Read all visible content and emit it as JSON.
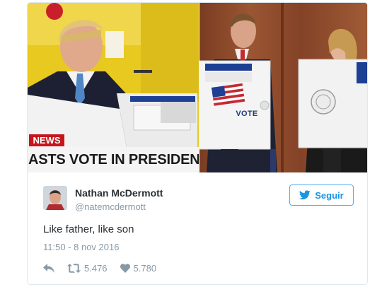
{
  "media": {
    "left_news_tag": "NEWS",
    "left_ticker": "ASTS VOTE IN PRESIDENTIAL",
    "right_booth_label": "VOTE"
  },
  "tweet": {
    "display_name": "Nathan McDermott",
    "screen_name": "@natemcdermott",
    "follow_label": "Seguir",
    "text": "Like father, like son",
    "timestamp": "11:50 - 8 nov 2016",
    "retweet_count": "5.476",
    "like_count": "5.780"
  },
  "icons": {
    "follow": "twitter-bird-icon",
    "reply": "reply-icon",
    "retweet": "retweet-icon",
    "like": "heart-icon"
  },
  "colors": {
    "twitter_blue": "#1b95e0",
    "border": "#e1e8ed",
    "muted_text": "#8899a6",
    "news_red": "#c4161c"
  }
}
